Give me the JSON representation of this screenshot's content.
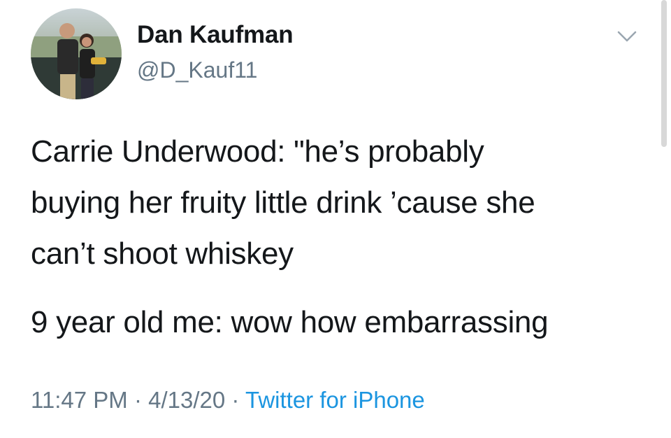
{
  "user": {
    "display_name": "Dan Kaufman",
    "handle": "@D_Kauf11"
  },
  "tweet": {
    "line1": "Carrie Underwood: \"he’s probably",
    "line2": "buying her fruity little drink ’cause she",
    "line3": "can’t shoot whiskey",
    "line4": "9 year old me: wow how embarrassing"
  },
  "meta": {
    "time": "11:47 PM",
    "separator": " · ",
    "date": "4/13/20",
    "source": "Twitter for iPhone"
  },
  "colors": {
    "text": "#14171a",
    "secondary": "#657786",
    "link": "#1b95e0"
  },
  "icons": {
    "menu": "chevron-down-icon"
  }
}
